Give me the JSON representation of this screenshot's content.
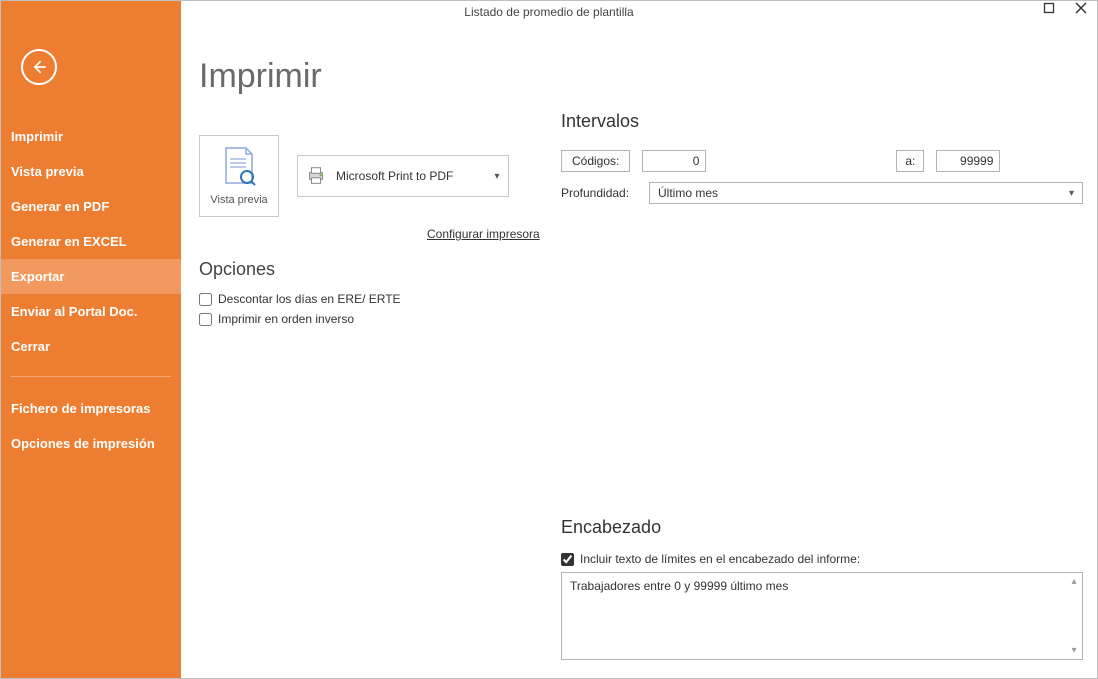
{
  "window": {
    "title": "Listado de promedio de plantilla"
  },
  "sidebar": {
    "items": [
      {
        "label": "Imprimir"
      },
      {
        "label": "Vista previa"
      },
      {
        "label": "Generar en PDF"
      },
      {
        "label": "Generar en EXCEL"
      },
      {
        "label": "Exportar"
      },
      {
        "label": "Enviar al Portal Doc."
      },
      {
        "label": "Cerrar"
      }
    ],
    "extra": [
      {
        "label": "Fichero de impresoras"
      },
      {
        "label": "Opciones de impresión"
      }
    ],
    "active_index": 4
  },
  "page": {
    "title": "Imprimir"
  },
  "actions": {
    "preview_label": "Vista previa",
    "printer_name": "Microsoft Print to PDF",
    "config_link": "Configurar impresora"
  },
  "opciones": {
    "heading": "Opciones",
    "chk1_label": "Descontar los días en ERE/ ERTE",
    "chk1_checked": false,
    "chk2_label": "Imprimir en orden inverso",
    "chk2_checked": false
  },
  "intervalos": {
    "heading": "Intervalos",
    "codigos_label": "Códigos:",
    "codigos_from": "0",
    "a_label": "a:",
    "codigos_to": "99999",
    "profundidad_label": "Profundidad:",
    "profundidad_value": "Último mes"
  },
  "encabezado": {
    "heading": "Encabezado",
    "incluir_label": "Incluir texto de límites en el encabezado del informe:",
    "incluir_checked": true,
    "texto": "Trabajadores entre 0 y 99999 último mes"
  }
}
